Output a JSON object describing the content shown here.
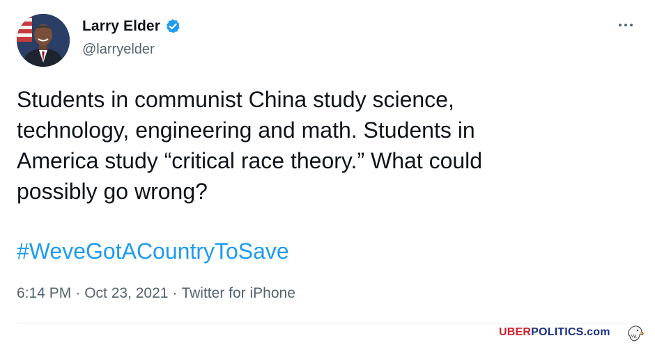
{
  "author": {
    "name": "Larry Elder",
    "handle": "@larryelder",
    "verified": true,
    "avatar_icon": "profile-photo"
  },
  "tweet": {
    "text": "Students in communist China study science,\ntechnology, engineering and math. Students in\nAmerica study “critical race theory.” What could\npossibly go wrong?",
    "hashtag": "#WeveGotACountryToSave"
  },
  "meta": {
    "time": "6:14 PM",
    "sep1": "·",
    "date": "Oct 23, 2021",
    "sep2": "·",
    "source": "Twitter for iPhone"
  },
  "watermark": {
    "part1": "UBER",
    "part2": "POLITICS",
    "part3": ".com",
    "logo_icon": "eagle-icon"
  },
  "colors": {
    "text": "#0f1419",
    "secondary": "#536471",
    "link": "#1d9bf0",
    "verified": "#1d9bf0",
    "watermark_red": "#d3202a",
    "watermark_blue": "#1a2f8a"
  }
}
